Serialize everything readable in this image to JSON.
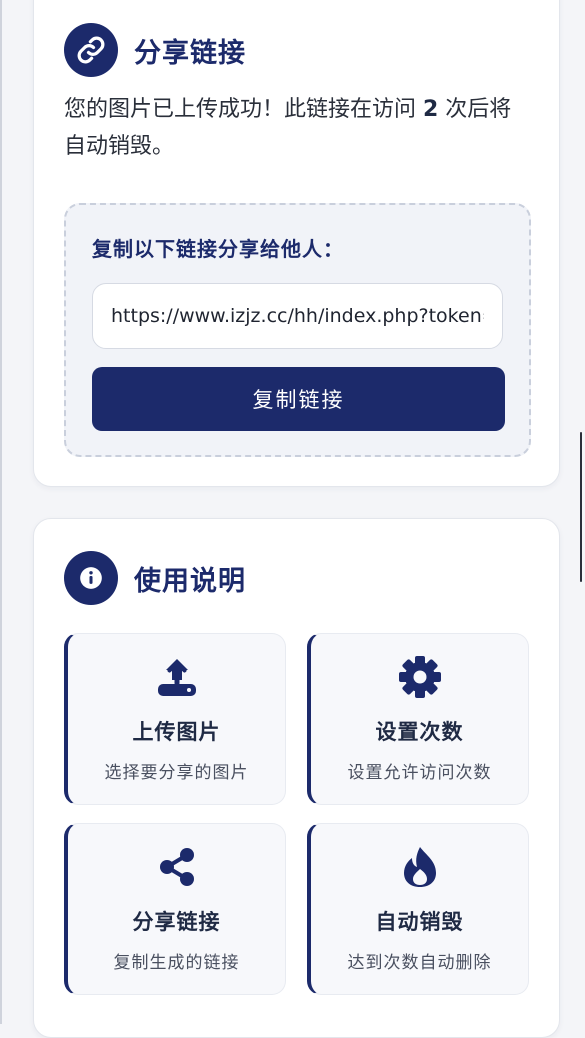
{
  "share": {
    "title": "分享链接",
    "icon": "link-icon",
    "desc_before": "您的图片已上传成功！此链接在访问 ",
    "visit_count": "2",
    "desc_after": " 次后将自动销毁。",
    "copy_label": "复制以下链接分享给他人：",
    "link_value": "https://www.izjz.cc/hh/index.php?token=",
    "copy_button_label": "复制链接"
  },
  "guide": {
    "title": "使用说明",
    "icon": "info-icon",
    "steps": [
      {
        "icon": "upload-icon",
        "title": "上传图片",
        "desc": "选择要分享的图片"
      },
      {
        "icon": "gear-icon",
        "title": "设置次数",
        "desc": "设置允许访问次数"
      },
      {
        "icon": "share-icon",
        "title": "分享链接",
        "desc": "复制生成的链接"
      },
      {
        "icon": "flame-icon",
        "title": "自动销毁",
        "desc": "达到次数自动删除"
      }
    ]
  },
  "colors": {
    "accent": "#1c2a6b",
    "card_background": "#ffffff",
    "page_background": "#f4f5f8"
  }
}
